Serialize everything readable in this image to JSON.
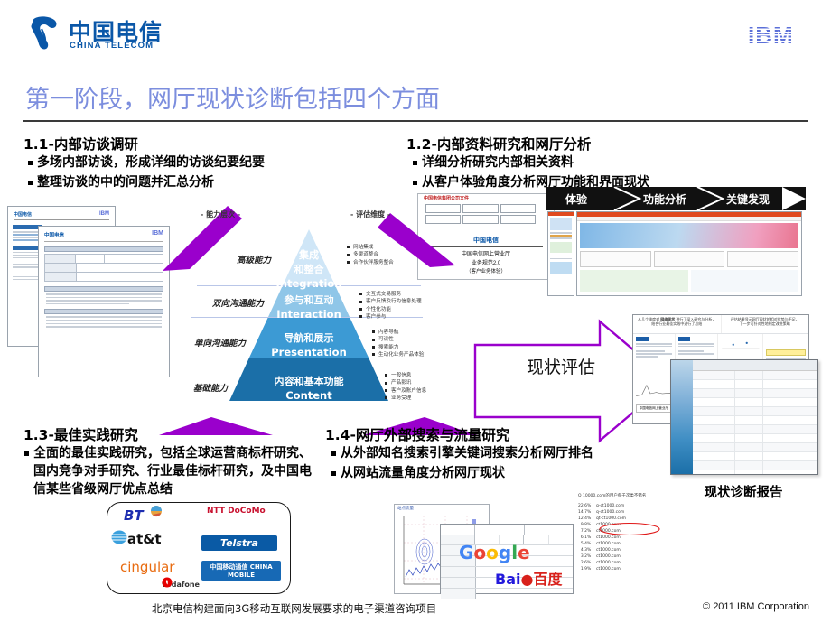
{
  "header": {
    "china_telecom_cn": "中国电信",
    "china_telecom_en": "CHINA TELECOM",
    "ibm_logo": "IBM"
  },
  "title": "第一阶段，网厅现状诊断包括四个方面",
  "sections": {
    "s11": {
      "heading": "1.1-内部访谈调研",
      "bullets": [
        "多场内部访谈，形成详细的访谈纪要纪要",
        "整理访谈的中的问题并汇总分析"
      ]
    },
    "s12": {
      "heading": "1.2-内部资料研究和网厅分析",
      "bullets": [
        "详细分析研究内部相关资料",
        "从客户体验角度分析网厅功能和界面现状"
      ],
      "doc_cover": {
        "top_label": "中国电信集团公司文件",
        "logo_cn": "中国电信",
        "line1": "中国电信网上营业厅",
        "line2": "业务规范2.0",
        "line3": "（客户业务体验）"
      },
      "chevrons": [
        "体验",
        "功能分析",
        "关键发现"
      ]
    },
    "s13": {
      "heading": "1.3-最佳实践研究",
      "bullets": [
        "全面的最佳实践研究，包括全球运营商标杆研究、国内竞争对手研究、行业最佳标杆研究，及中国电信某些省级网厅优点总结"
      ],
      "logos": [
        "BT",
        "NTT DoCoMo",
        "at&t",
        "Telstra",
        "cingular",
        "中国移动通信 CHINA MOBILE",
        "vodafone"
      ]
    },
    "s14": {
      "heading": "1.4-网厅外部搜索与流量研究",
      "bullets": [
        "从外部知名搜索引擎关键词搜索分析网厅排名",
        "从网站流量角度分析网厅现状"
      ],
      "search_engines": [
        "Google",
        "Baidu 百度"
      ]
    }
  },
  "assessment": {
    "arrow_label": "现状评估",
    "report_caption": "现状诊断报告"
  },
  "pyramid": {
    "left_header": "- 能力层次 -",
    "right_header": "- 评估维度 -",
    "tiers": [
      {
        "level_label": "高级能力",
        "name_cn": "集成\n和整合",
        "name_cn_line1": "集成",
        "name_cn_line2": "和整合",
        "name_en": "Integration",
        "color": "#cfe6f7",
        "details": [
          "网站集成",
          "多渠道整合",
          "合作伙伴服务整合"
        ]
      },
      {
        "level_label": "双向沟通能力",
        "name_cn_line1": "参与和互动",
        "name_cn_line2": "",
        "name_en": "Interaction",
        "color": "#8fc6e8",
        "details": [
          "交互式交易服务",
          "客户反馈及行为信息处理",
          "个性化功能",
          "客户参与"
        ]
      },
      {
        "level_label": "单向沟通能力",
        "name_cn_line1": "导航和展示",
        "name_cn_line2": "",
        "name_en": "Presentation",
        "color": "#3c9ad4",
        "details": [
          "内容导航",
          "可读性",
          "搜索能力",
          "生动化业务产品体验"
        ]
      },
      {
        "level_label": "基础能力",
        "name_cn_line1": "内容和基本功能",
        "name_cn_line2": "",
        "name_en": "Content",
        "color": "#1b6fa8",
        "details": [
          "一般信息",
          "产品影讯",
          "客户及账户信息",
          "业务受理"
        ]
      }
    ]
  },
  "footer": {
    "project": "北京电信构建面向3G移动互联网发展要求的电子渠道咨询项目",
    "copyright": "© 2011 IBM Corporation"
  },
  "colors": {
    "title_blue": "#7c8ede",
    "purple": "#9a00cc",
    "ct_blue": "#0a57a8",
    "ibm_blue": "#5b6fd8"
  }
}
